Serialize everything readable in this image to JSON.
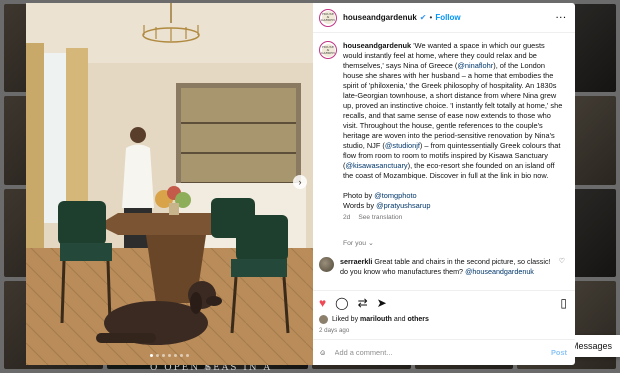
{
  "background": {
    "caption": "O OPEN SEAS IN A",
    "messages_label": "Messages"
  },
  "post": {
    "username": "houseandgardenuk",
    "follow_label": "Follow",
    "more_icon": "more-icon",
    "avatar_text": "HOUSE & GARDEN",
    "caption": {
      "username": "houseandgardenuk",
      "text_a": " 'We wanted a space in which our guests would instantly feel at home, where they could relax and be themselves,' says Nina of Greece (",
      "mention_nina": "@ninaflohr",
      "text_b": "), of the London house she shares with her husband – a home that embodies the spirit of 'philoxenia,' the Greek philosophy of hospitality. An 1830s late-Georgian townhouse, a short distance from where Nina grew up, proved an instinctive choice. 'I instantly felt totally at home,' she recalls, and that same sense of ease now extends to those who visit. Throughout the house, gentle references to the couple's heritage are woven into the period-sensitive renovation by Nina's studio, NJF (",
      "mention_studio": "@studionjf",
      "text_c": ") – from quintessentially Greek colours that flow from room to room to motifs inspired by Kisawa Sanctuary (",
      "mention_kisawa": "@kisawasanctuary",
      "text_d": "), the eco-resort she founded on an island off the coast of Mozambique. Discover in full at the link in bio now."
    },
    "photo_credit_prefix": "Photo by ",
    "photo_credit": "@tomgphoto",
    "words_prefix": "Words by ",
    "words_credit": "@pratyushsarup",
    "caption_age": "2d",
    "see_translation": "See translation",
    "for_you": "For you",
    "comment": {
      "username": "serraerkli",
      "text": " Great table and chairs in the second picture, so classic!",
      "text2": "do you know who manufactures them? ",
      "mention": "@houseandgardenuk"
    },
    "likes_prefix": "Liked by ",
    "liked_by": "marilouth",
    "likes_suffix": " and ",
    "likes_others": "others",
    "posted_ago": "2 days ago",
    "add_comment_placeholder": "Add a comment...",
    "post_label": "Post",
    "carousel": {
      "total": 7,
      "active": 1
    }
  },
  "colors": {
    "accent": "#0095f6",
    "like": "#ed4956",
    "link": "#00376b"
  }
}
